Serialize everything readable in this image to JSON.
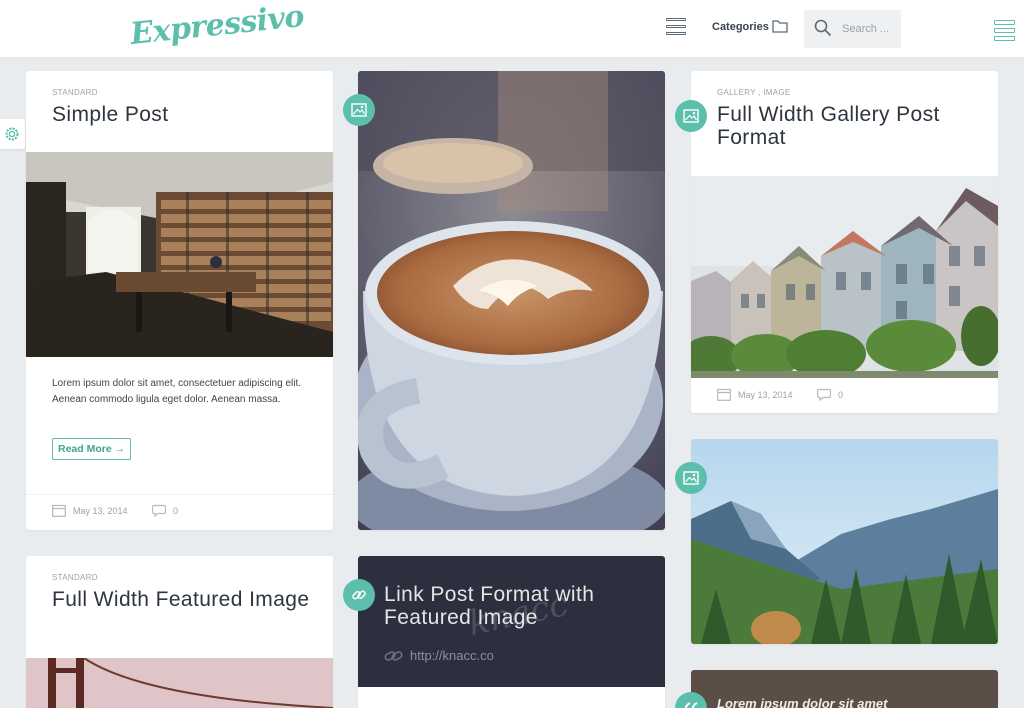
{
  "header": {
    "logo": "Expressivo",
    "categories_label": "Categories",
    "search_placeholder": "Search ..."
  },
  "posts": {
    "simple": {
      "category": "STANDARD",
      "title": "Simple Post",
      "excerpt": "Lorem ipsum dolor sit amet, consectetuer adipiscing elit. Aenean commodo ligula eget dolor. Aenean massa.",
      "read_more": "Read More →",
      "date": "May 13, 2014",
      "comments": "0"
    },
    "gallery": {
      "category": "GALLERY , IMAGE",
      "title": "Full Width Gallery Post Format",
      "date": "May 13, 2014",
      "comments": "0"
    },
    "featured": {
      "category": "STANDARD",
      "title": "Full Width Featured Image"
    },
    "link": {
      "title": "Link Post Format with Featured Image",
      "url": "http://knacc.co",
      "watermark": "knacc"
    },
    "quote": {
      "text": "Lorem ipsum dolor sit amet"
    }
  },
  "colors": {
    "accent": "#5bbfac",
    "background": "#e9ecee",
    "dark_card": "#2c2f3e"
  }
}
